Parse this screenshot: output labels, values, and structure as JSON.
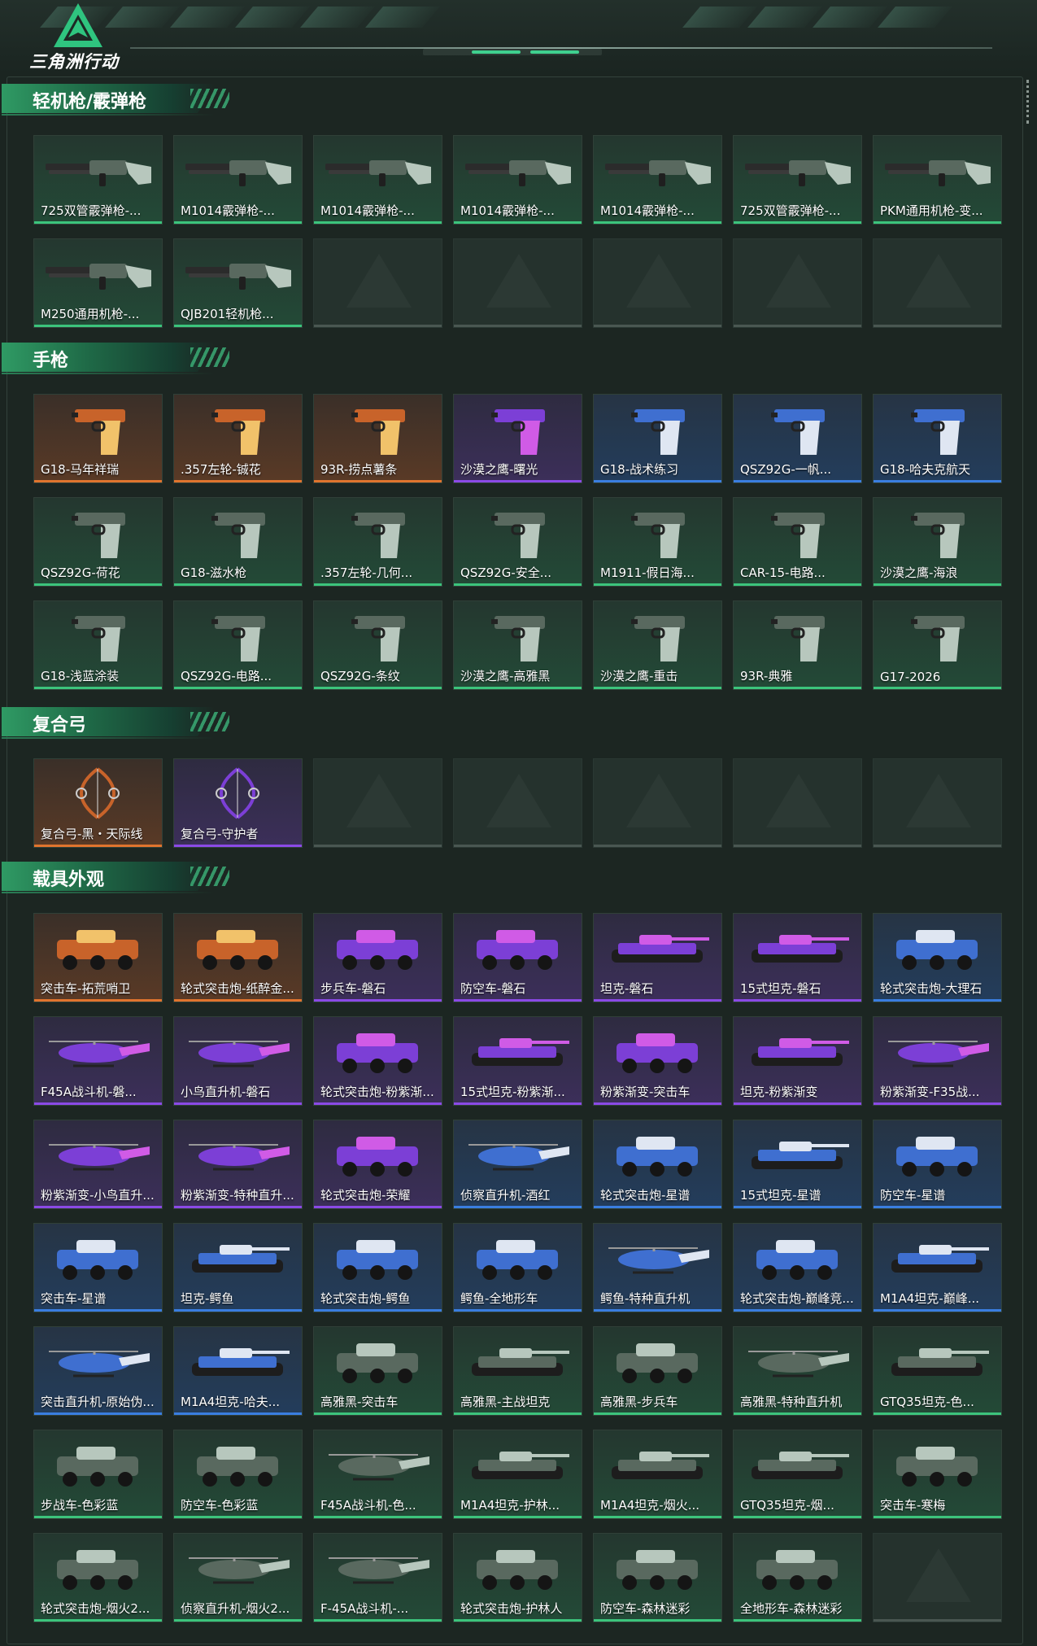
{
  "app": {
    "logo_text": "三角洲行动"
  },
  "colors": {
    "orange": "#e0742e",
    "purple": "#8b4ae6",
    "blue": "#3a7ee0",
    "green": "#3cc47c",
    "accent": "#2f9a64"
  },
  "sections": [
    {
      "title": "轻机枪/霰弹枪",
      "kind": "gun",
      "items": [
        {
          "label": "725双管霰弹枪-...",
          "quality": "green"
        },
        {
          "label": "M1014霰弹枪-...",
          "quality": "green"
        },
        {
          "label": "M1014霰弹枪-...",
          "quality": "green"
        },
        {
          "label": "M1014霰弹枪-...",
          "quality": "green"
        },
        {
          "label": "M1014霰弹枪-...",
          "quality": "green"
        },
        {
          "label": "725双管霰弹枪-...",
          "quality": "green"
        },
        {
          "label": "PKM通用机枪-变...",
          "quality": "green"
        },
        {
          "label": "M250通用机枪-...",
          "quality": "green"
        },
        {
          "label": "QJB201轻机枪...",
          "quality": "green"
        },
        {
          "label": "",
          "quality": "empty"
        },
        {
          "label": "",
          "quality": "empty"
        },
        {
          "label": "",
          "quality": "empty"
        },
        {
          "label": "",
          "quality": "empty"
        },
        {
          "label": "",
          "quality": "empty"
        }
      ]
    },
    {
      "title": "手枪",
      "kind": "pistol",
      "items": [
        {
          "label": "G18-马年祥瑞",
          "quality": "orange"
        },
        {
          "label": ".357左轮-铖花",
          "quality": "orange"
        },
        {
          "label": "93R-捞点薯条",
          "quality": "orange"
        },
        {
          "label": "沙漠之鹰-曙光",
          "quality": "purple"
        },
        {
          "label": "G18-战术练习",
          "quality": "blue"
        },
        {
          "label": "QSZ92G-一帆...",
          "quality": "blue"
        },
        {
          "label": "G18-哈夫克航天",
          "quality": "blue"
        },
        {
          "label": "QSZ92G-荷花",
          "quality": "green"
        },
        {
          "label": "G18-滋水枪",
          "quality": "green"
        },
        {
          "label": ".357左轮-几何...",
          "quality": "green"
        },
        {
          "label": "QSZ92G-安全...",
          "quality": "green"
        },
        {
          "label": "M1911-假日海...",
          "quality": "green"
        },
        {
          "label": "CAR-15-电路...",
          "quality": "green"
        },
        {
          "label": "沙漠之鹰-海浪",
          "quality": "green"
        },
        {
          "label": "G18-浅蓝涂装",
          "quality": "green"
        },
        {
          "label": "QSZ92G-电路...",
          "quality": "green"
        },
        {
          "label": "QSZ92G-条纹",
          "quality": "green"
        },
        {
          "label": "沙漠之鹰-高雅黑",
          "quality": "green"
        },
        {
          "label": "沙漠之鹰-重击",
          "quality": "green"
        },
        {
          "label": "93R-典雅",
          "quality": "green"
        },
        {
          "label": "G17-2026",
          "quality": "green"
        }
      ]
    },
    {
      "title": "复合弓",
      "kind": "bow",
      "items": [
        {
          "label": "复合弓-黑・天际线",
          "quality": "orange"
        },
        {
          "label": "复合弓-守护者",
          "quality": "purple"
        },
        {
          "label": "",
          "quality": "empty"
        },
        {
          "label": "",
          "quality": "empty"
        },
        {
          "label": "",
          "quality": "empty"
        },
        {
          "label": "",
          "quality": "empty"
        },
        {
          "label": "",
          "quality": "empty"
        }
      ]
    },
    {
      "title": "载具外观",
      "kind": "vehicle",
      "items": [
        {
          "label": "突击车-拓荒哨卫",
          "quality": "orange"
        },
        {
          "label": "轮式突击炮-纸醉金...",
          "quality": "orange"
        },
        {
          "label": "步兵车-磐石",
          "quality": "purple"
        },
        {
          "label": "防空车-磐石",
          "quality": "purple"
        },
        {
          "label": "坦克-磐石",
          "quality": "purple"
        },
        {
          "label": "15式坦克-磐石",
          "quality": "purple"
        },
        {
          "label": "轮式突击炮-大理石",
          "quality": "blue"
        },
        {
          "label": "F45A战斗机-磐...",
          "quality": "purple"
        },
        {
          "label": "小鸟直升机-磐石",
          "quality": "purple"
        },
        {
          "label": "轮式突击炮-粉紫渐...",
          "quality": "purple"
        },
        {
          "label": "15式坦克-粉紫渐...",
          "quality": "purple"
        },
        {
          "label": "粉紫渐变-突击车",
          "quality": "purple"
        },
        {
          "label": "坦克-粉紫渐变",
          "quality": "purple"
        },
        {
          "label": "粉紫渐变-F35战...",
          "quality": "purple"
        },
        {
          "label": "粉紫渐变-小鸟直升...",
          "quality": "purple"
        },
        {
          "label": "粉紫渐变-特种直升...",
          "quality": "purple"
        },
        {
          "label": "轮式突击炮-荣耀",
          "quality": "purple"
        },
        {
          "label": "侦察直升机-酒红",
          "quality": "blue"
        },
        {
          "label": "轮式突击炮-星谱",
          "quality": "blue"
        },
        {
          "label": "15式坦克-星谱",
          "quality": "blue"
        },
        {
          "label": "防空车-星谱",
          "quality": "blue"
        },
        {
          "label": "突击车-星谱",
          "quality": "blue"
        },
        {
          "label": "坦克-鳄鱼",
          "quality": "blue"
        },
        {
          "label": "轮式突击炮-鳄鱼",
          "quality": "blue"
        },
        {
          "label": "鳄鱼-全地形车",
          "quality": "blue"
        },
        {
          "label": "鳄鱼-特种直升机",
          "quality": "blue"
        },
        {
          "label": "轮式突击炮-巅峰竞...",
          "quality": "blue"
        },
        {
          "label": "M1A4坦克-巅峰...",
          "quality": "blue"
        },
        {
          "label": "突击直升机-原始伪...",
          "quality": "blue"
        },
        {
          "label": "M1A4坦克-哈夫...",
          "quality": "blue"
        },
        {
          "label": "高雅黑-突击车",
          "quality": "green"
        },
        {
          "label": "高雅黑-主战坦克",
          "quality": "green"
        },
        {
          "label": "高雅黑-步兵车",
          "quality": "green"
        },
        {
          "label": "高雅黑-特种直升机",
          "quality": "green"
        },
        {
          "label": "GTQ35坦克-色...",
          "quality": "green"
        },
        {
          "label": "步战车-色彩蓝",
          "quality": "green"
        },
        {
          "label": "防空车-色彩蓝",
          "quality": "green"
        },
        {
          "label": "F45A战斗机-色...",
          "quality": "green"
        },
        {
          "label": "M1A4坦克-护林...",
          "quality": "green"
        },
        {
          "label": "M1A4坦克-烟火...",
          "quality": "green"
        },
        {
          "label": "GTQ35坦克-烟...",
          "quality": "green"
        },
        {
          "label": "突击车-寒梅",
          "quality": "green"
        },
        {
          "label": "轮式突击炮-烟火2...",
          "quality": "green"
        },
        {
          "label": "侦察直升机-烟火2...",
          "quality": "green"
        },
        {
          "label": "F-45A战斗机-...",
          "quality": "green"
        },
        {
          "label": "轮式突击炮-护林人",
          "quality": "green"
        },
        {
          "label": "防空车-森林迷彩",
          "quality": "green"
        },
        {
          "label": "全地形车-森林迷彩",
          "quality": "green"
        },
        {
          "label": "",
          "quality": "empty"
        }
      ]
    }
  ]
}
